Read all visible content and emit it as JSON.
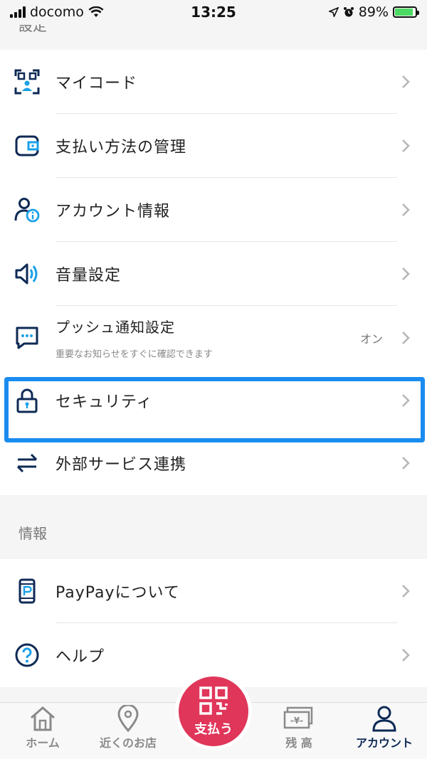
{
  "status_bar": {
    "carrier": "docomo",
    "time": "13:25",
    "battery": "89%"
  },
  "sections": {
    "settings_header": "設定",
    "info_header": "情報"
  },
  "settings": {
    "my_code": "マイコード",
    "payment_methods": "支払い方法の管理",
    "account_info": "アカウント情報",
    "sound": "音量設定",
    "push": "プッシュ通知設定",
    "push_sub": "重要なお知らせをすぐに確認できます",
    "push_value": "オン",
    "security": "セキュリティ",
    "external": "外部サービス連携"
  },
  "info": {
    "about": "PayPayについて",
    "help": "ヘルプ"
  },
  "tabbar": {
    "home": "ホーム",
    "nearby": "近くのお店",
    "pay": "支払う",
    "balance": "残 高",
    "account": "アカウント"
  },
  "colors": {
    "primary": "#0e2a55",
    "accent": "#1a8cf0",
    "pay": "#e0365a"
  }
}
